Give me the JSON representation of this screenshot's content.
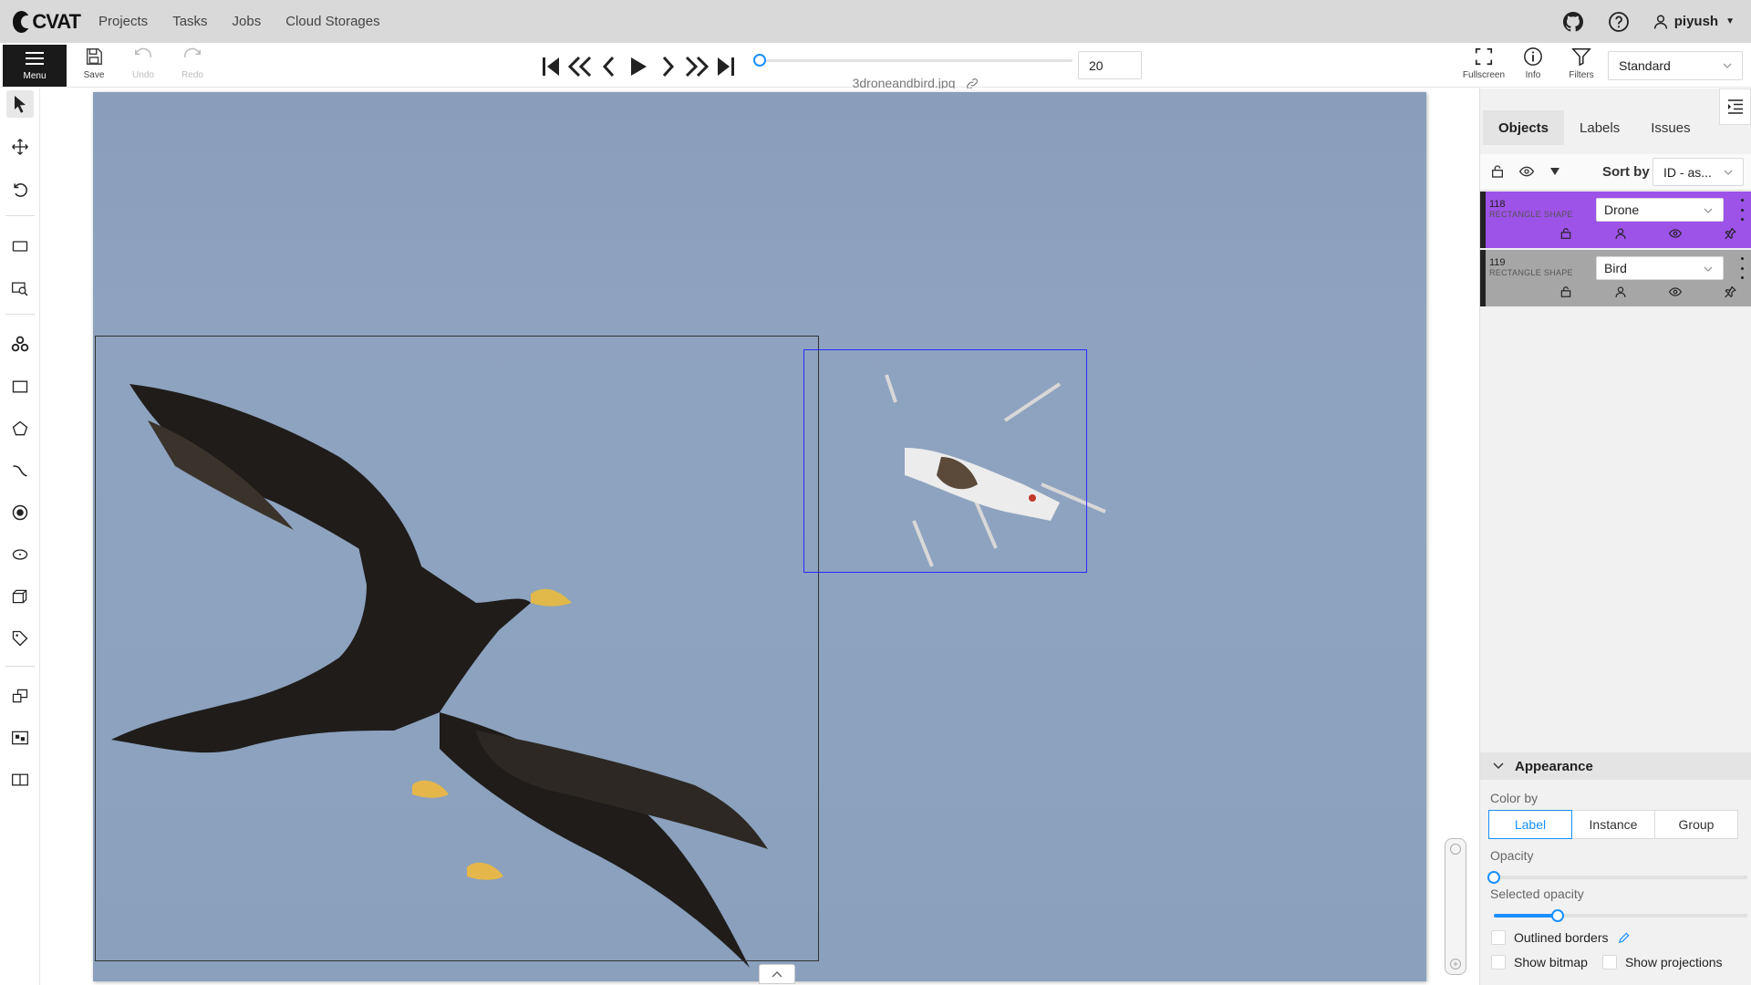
{
  "app": {
    "logo_text": "CVAT"
  },
  "nav": {
    "items": [
      "Projects",
      "Tasks",
      "Jobs",
      "Cloud Storages"
    ]
  },
  "header": {
    "username": "piyush",
    "icons": [
      "github-icon",
      "help-icon",
      "user-icon"
    ]
  },
  "toolbar": {
    "menu_label": "Menu",
    "save_label": "Save",
    "undo_label": "Undo",
    "redo_label": "Redo",
    "filename": "3droneandbird.jpg",
    "frame_number": "20",
    "frame_progress": 0.0,
    "fullscreen_label": "Fullscreen",
    "info_label": "Info",
    "filters_label": "Filters",
    "workspace_value": "Standard"
  },
  "tools": [
    "cursor-tool",
    "move-tool",
    "rotate-tool",
    "fit-image-tool",
    "zoom-region-tool",
    "opencv-tool",
    "rectangle-tool",
    "polygon-tool",
    "polyline-tool",
    "points-tool",
    "ellipse-tool",
    "cuboid-tool",
    "tag-tool",
    "merge-tool",
    "group-tool",
    "split-tool"
  ],
  "sidebar": {
    "tabs": [
      "Objects",
      "Labels",
      "Issues"
    ],
    "active_tab": "Objects",
    "sort_label": "Sort by",
    "sort_value": "ID - as...",
    "objects": [
      {
        "id": "118",
        "type": "RECTANGLE SHAPE",
        "label": "Drone",
        "color": "#9d52e8"
      },
      {
        "id": "119",
        "type": "RECTANGLE SHAPE",
        "label": "Bird",
        "color": "#a6a6a6"
      }
    ]
  },
  "appearance": {
    "title": "Appearance",
    "color_by_label": "Color by",
    "color_by_options": [
      "Label",
      "Instance",
      "Group"
    ],
    "color_by_selected": "Label",
    "opacity_label": "Opacity",
    "opacity_value": 0.0,
    "selected_opacity_label": "Selected opacity",
    "selected_opacity_value": 0.25,
    "outlined_borders_label": "Outlined borders",
    "show_bitmap_label": "Show bitmap",
    "show_projections_label": "Show projections"
  },
  "colors": {
    "accent": "#1890ff",
    "header_bg": "#d9d9d9",
    "drone_box": "#2b2bff",
    "bird_box": "#333333"
  }
}
